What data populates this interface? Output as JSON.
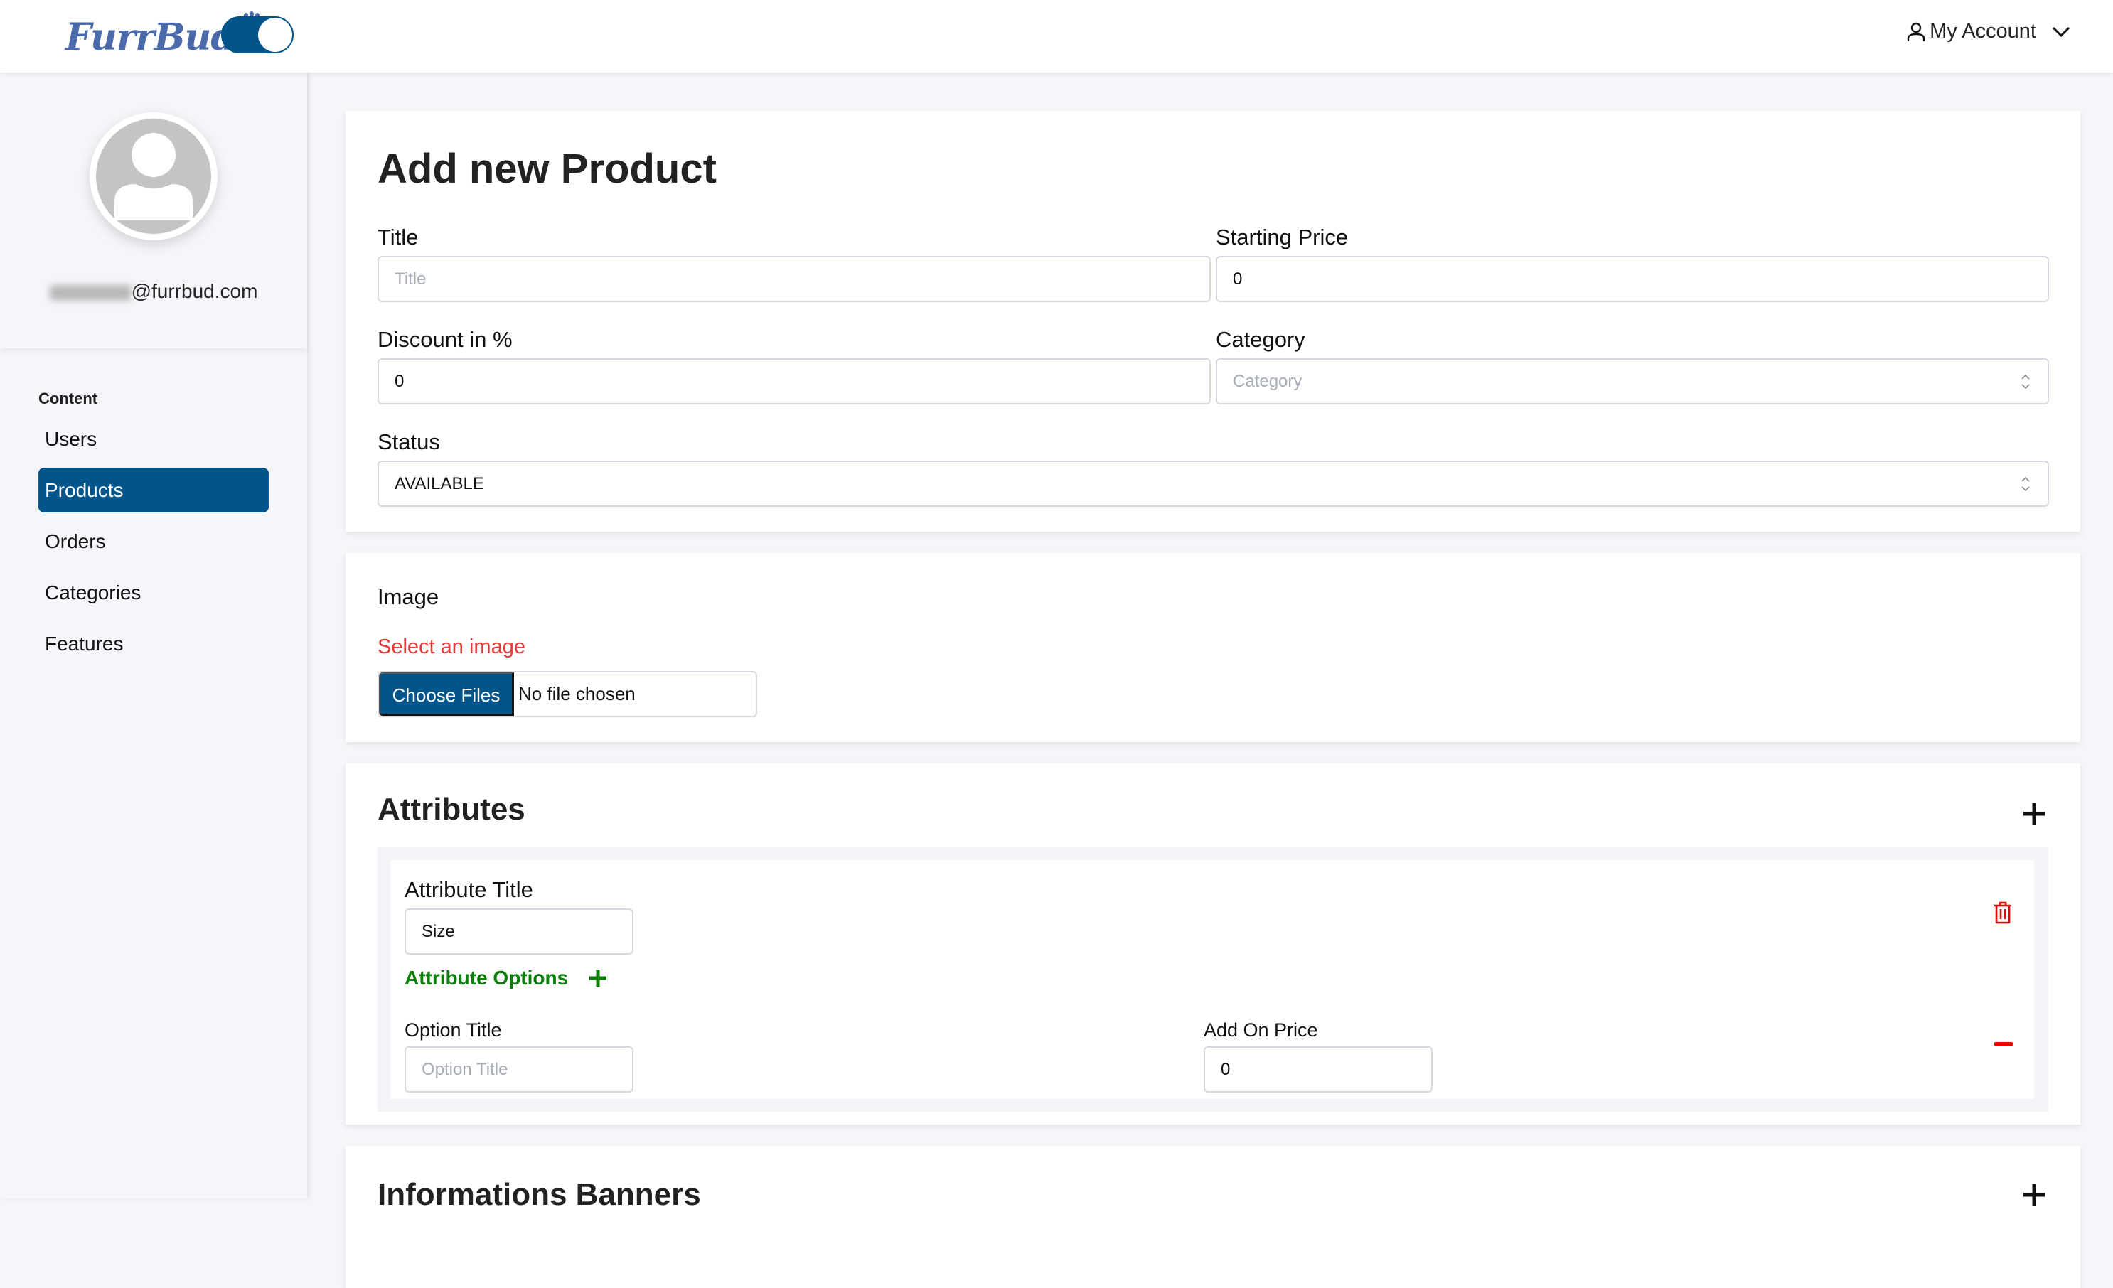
{
  "header": {
    "brand": "FurrBud",
    "theme_toggle_on": true,
    "account_label": "My Account"
  },
  "sidebar": {
    "email_visible": "@furrbud.com",
    "section_heading": "Content",
    "items": [
      {
        "label": "Users",
        "active": false
      },
      {
        "label": "Products",
        "active": true
      },
      {
        "label": "Orders",
        "active": false
      },
      {
        "label": "Categories",
        "active": false
      },
      {
        "label": "Features",
        "active": false
      }
    ]
  },
  "form": {
    "page_title": "Add new Product",
    "title": {
      "label": "Title",
      "value": "",
      "placeholder": "Title"
    },
    "starting_price": {
      "label": "Starting Price",
      "value": "0"
    },
    "discount": {
      "label": "Discount in %",
      "value": "0"
    },
    "category": {
      "label": "Category",
      "value": "",
      "placeholder": "Category"
    },
    "status": {
      "label": "Status",
      "value": "AVAILABLE"
    }
  },
  "image_section": {
    "label": "Image",
    "error": "Select an image",
    "choose_button": "Choose Files",
    "file_status": "No file chosen"
  },
  "attributes": {
    "title": "Attributes",
    "items": [
      {
        "title_label": "Attribute Title",
        "title_value": "Size",
        "options_label": "Attribute Options",
        "options": [
          {
            "option_title_label": "Option Title",
            "option_title_value": "",
            "option_title_placeholder": "Option Title",
            "add_on_price_label": "Add On Price",
            "add_on_price_value": "0"
          }
        ]
      }
    ]
  },
  "information_banners": {
    "title": "Informations Banners"
  },
  "colors": {
    "primary": "#02558b",
    "brand": "#4a6aaa",
    "error": "#e53935",
    "success": "#0a7d0a",
    "danger": "#ee0000"
  }
}
